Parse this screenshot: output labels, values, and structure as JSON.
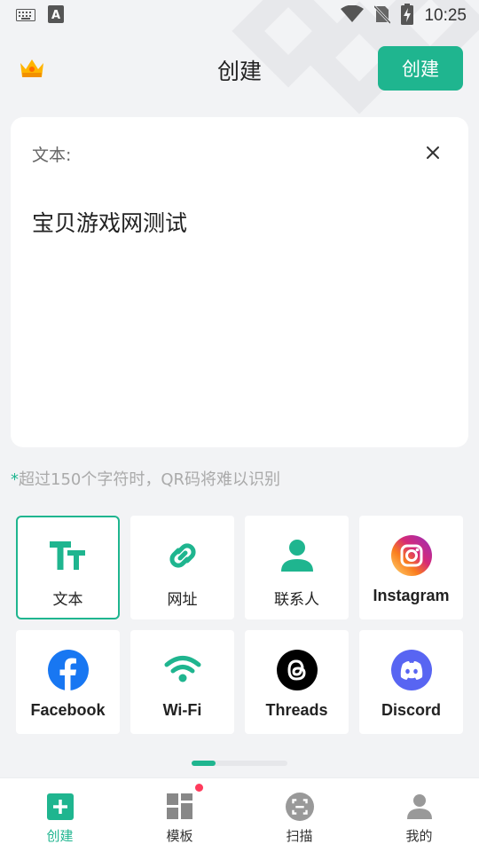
{
  "status_bar": {
    "time": "10:25",
    "icons": [
      "keyboard-icon",
      "a-icon",
      "wifi-icon",
      "no-sim-icon",
      "battery-charging-icon"
    ]
  },
  "header": {
    "title": "创建",
    "create_label": "创建",
    "crown_icon": "crown-icon"
  },
  "card": {
    "label": "文本:",
    "text": "宝贝游戏网测试",
    "close_icon": "close-icon"
  },
  "hint": {
    "star": "*",
    "text": "超过150个字符时，QR码将难以识别"
  },
  "types": [
    {
      "label": "文本",
      "icon": "text-icon"
    },
    {
      "label": "网址",
      "icon": "link-icon"
    },
    {
      "label": "联系人",
      "icon": "contact-icon"
    },
    {
      "label": "Instagram",
      "icon": "instagram-icon"
    },
    {
      "label": "Facebook",
      "icon": "facebook-icon"
    },
    {
      "label": "Wi-Fi",
      "icon": "wifi-icon"
    },
    {
      "label": "Threads",
      "icon": "threads-icon"
    },
    {
      "label": "Discord",
      "icon": "discord-icon"
    }
  ],
  "pager": {
    "pages": 4,
    "current": 1
  },
  "nav": [
    {
      "label": "创建",
      "icon": "plus-square-icon"
    },
    {
      "label": "模板",
      "icon": "template-icon"
    },
    {
      "label": "扫描",
      "icon": "scan-icon"
    },
    {
      "label": "我的",
      "icon": "person-icon"
    }
  ],
  "colors": {
    "accent": "#1fb58f",
    "badge": "#ff3b5c",
    "background": "#f2f3f5"
  }
}
